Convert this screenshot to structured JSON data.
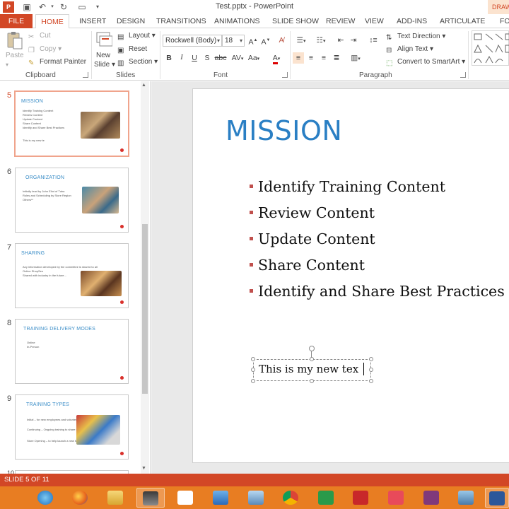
{
  "window": {
    "title": "Test.pptx - PowerPoint",
    "contextual_tab": "DRAW"
  },
  "tabs": [
    {
      "label": "FILE"
    },
    {
      "label": "HOME"
    },
    {
      "label": "INSERT"
    },
    {
      "label": "DESIGN"
    },
    {
      "label": "TRANSITIONS"
    },
    {
      "label": "ANIMATIONS"
    },
    {
      "label": "SLIDE SHOW"
    },
    {
      "label": "REVIEW"
    },
    {
      "label": "VIEW"
    },
    {
      "label": "ADD-INS"
    },
    {
      "label": "ARTICULATE"
    },
    {
      "label": "FO"
    }
  ],
  "ribbon": {
    "clipboard": {
      "paste": "Paste",
      "cut": "Cut",
      "copy": "Copy",
      "format_painter": "Format Painter",
      "group": "Clipboard"
    },
    "slides": {
      "new_slide": "New",
      "new_slide2": "Slide",
      "layout": "Layout",
      "reset": "Reset",
      "section": "Section",
      "group": "Slides"
    },
    "font": {
      "name": "Rockwell (Body)",
      "size": "18",
      "group": "Font",
      "bold": "B",
      "italic": "I",
      "underline": "U",
      "shadow": "S",
      "strike": "abc",
      "spacing": "AV",
      "case": "Aa",
      "color": "A"
    },
    "paragraph": {
      "text_direction": "Text Direction",
      "align_text": "Align Text",
      "convert": "Convert to SmartArt",
      "group": "Paragraph"
    }
  },
  "thumbnails": [
    {
      "num": "5",
      "title": "MISSION",
      "lines": [
        "Identify Training Content",
        "Review Content",
        "Update Content",
        "Share Content",
        "Identify and Share Best Practices",
        "",
        "This is my new te"
      ]
    },
    {
      "num": "6",
      "title": "ORGANIZATION",
      "lines": [
        "Initially lead by John Eliot of Tuba",
        "Roles and Scheduling by Store Region",
        "Others**"
      ]
    },
    {
      "num": "7",
      "title": "SHARING",
      "lines": [
        "Any information developed by the committee is shared to all",
        "Online ShopSen",
        "Shared with industry in the future..."
      ]
    },
    {
      "num": "8",
      "title": "TRAINING DELIVERY MODES",
      "lines": [
        "Online",
        "In-Person"
      ]
    },
    {
      "num": "9",
      "title": "TRAINING TYPES",
      "lines": [
        "Initial – for new employees and volunteers",
        "Continuing – Ongoing training to share new information",
        "Store Opening – to help launch a new facility"
      ]
    },
    {
      "num": "10"
    }
  ],
  "slide": {
    "title": "MISSION",
    "bullets": [
      "Identify Training Content",
      "Review Content",
      "Update Content",
      "Share Content",
      "Identify and Share Best Practices"
    ],
    "new_text": "This is my new tex"
  },
  "status": {
    "slide_counter": "SLIDE 5 OF 11"
  },
  "colors": {
    "accent": "#d24726",
    "title_blue": "#2a7fc4",
    "bullet": "#c0504d",
    "taskbar": "#e87d22"
  }
}
